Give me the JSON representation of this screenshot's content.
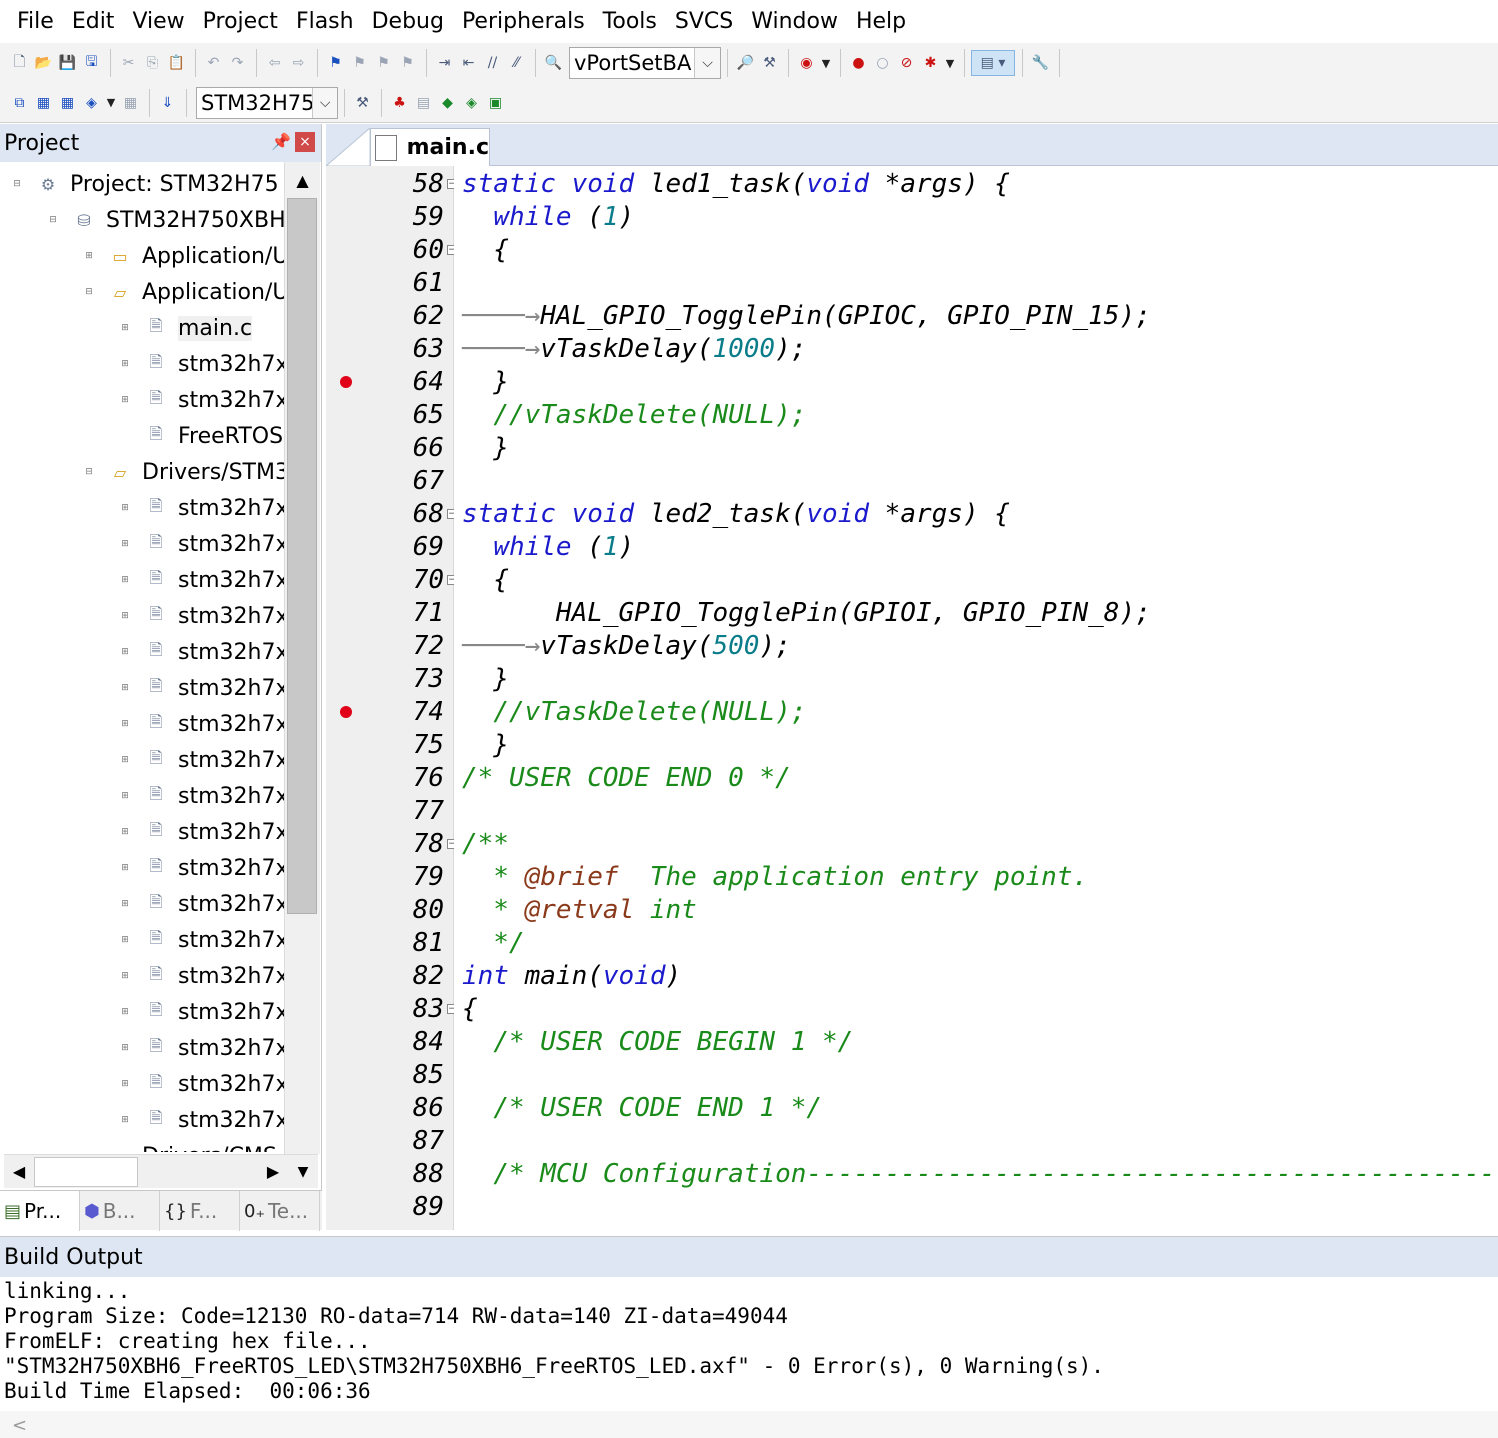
{
  "menu": [
    "File",
    "Edit",
    "View",
    "Project",
    "Flash",
    "Debug",
    "Peripherals",
    "Tools",
    "SVCS",
    "Window",
    "Help"
  ],
  "toolbar1": {
    "function_combo": "vPortSetBA"
  },
  "toolbar2": {
    "target_combo": "STM32H75"
  },
  "project_panel": {
    "title": "Project",
    "tree": [
      {
        "label": "Project: STM32H75",
        "type": "project",
        "level": 0
      },
      {
        "label": "STM32H750XBH",
        "type": "target",
        "level": 1
      },
      {
        "label": "Application/U",
        "type": "folder",
        "level": 2
      },
      {
        "label": "Application/U",
        "type": "folder-open",
        "level": 2
      },
      {
        "label": "main.c",
        "type": "file",
        "level": 3,
        "selected": true
      },
      {
        "label": "stm32h7x",
        "type": "file",
        "level": 3
      },
      {
        "label": "stm32h7x",
        "type": "file",
        "level": 3
      },
      {
        "label": "FreeRTOS",
        "type": "file",
        "level": 3
      },
      {
        "label": "Drivers/STM3",
        "type": "folder-open",
        "level": 2
      },
      {
        "label": "stm32h7x",
        "type": "file",
        "level": 3
      },
      {
        "label": "stm32h7x",
        "type": "file",
        "level": 3
      },
      {
        "label": "stm32h7x",
        "type": "file",
        "level": 3
      },
      {
        "label": "stm32h7x",
        "type": "file",
        "level": 3
      },
      {
        "label": "stm32h7x",
        "type": "file",
        "level": 3
      },
      {
        "label": "stm32h7x",
        "type": "file",
        "level": 3
      },
      {
        "label": "stm32h7x",
        "type": "file",
        "level": 3
      },
      {
        "label": "stm32h7x",
        "type": "file",
        "level": 3
      },
      {
        "label": "stm32h7x",
        "type": "file",
        "level": 3
      },
      {
        "label": "stm32h7x",
        "type": "file",
        "level": 3
      },
      {
        "label": "stm32h7x",
        "type": "file",
        "level": 3
      },
      {
        "label": "stm32h7x",
        "type": "file",
        "level": 3
      },
      {
        "label": "stm32h7x",
        "type": "file",
        "level": 3
      },
      {
        "label": "stm32h7x",
        "type": "file",
        "level": 3
      },
      {
        "label": "stm32h7x",
        "type": "file",
        "level": 3
      },
      {
        "label": "stm32h7x",
        "type": "file",
        "level": 3
      },
      {
        "label": "stm32h7x",
        "type": "file",
        "level": 3
      },
      {
        "label": "stm32h7x",
        "type": "file",
        "level": 3
      },
      {
        "label": "Drivers/CMS",
        "type": "folder",
        "level": 2
      }
    ],
    "bottom_tabs": [
      "Pr...",
      "B...",
      "F...",
      "Te..."
    ]
  },
  "editor": {
    "active_tab": "main.c",
    "lines": [
      {
        "n": "58",
        "bp": false,
        "fold": true,
        "tokens": [
          [
            "kw",
            "static void "
          ],
          [
            "",
            "led1_task("
          ],
          [
            "kw",
            "void "
          ],
          [
            "",
            "*args) {"
          ]
        ]
      },
      {
        "n": "59",
        "bp": false,
        "fold": false,
        "tokens": [
          [
            "",
            "  "
          ],
          [
            "kw",
            "while "
          ],
          [
            "",
            "("
          ],
          [
            "num",
            "1"
          ],
          [
            "",
            ")"
          ]
        ]
      },
      {
        "n": "60",
        "bp": false,
        "fold": true,
        "tokens": [
          [
            "",
            "  {"
          ]
        ]
      },
      {
        "n": "61",
        "bp": false,
        "fold": false,
        "tokens": [
          [
            "",
            "    "
          ]
        ]
      },
      {
        "n": "62",
        "bp": false,
        "fold": false,
        "tokens": [
          [
            "arrow",
            "────→"
          ],
          [
            "",
            "HAL_GPIO_TogglePin(GPIOC, GPIO_PIN_15);"
          ]
        ]
      },
      {
        "n": "63",
        "bp": false,
        "fold": false,
        "tokens": [
          [
            "arrow",
            "────→"
          ],
          [
            "",
            "vTaskDelay("
          ],
          [
            "num",
            "1000"
          ],
          [
            "",
            ");"
          ]
        ]
      },
      {
        "n": "64",
        "bp": true,
        "fold": false,
        "tokens": [
          [
            "",
            "  }"
          ]
        ]
      },
      {
        "n": "65",
        "bp": false,
        "fold": false,
        "tokens": [
          [
            "",
            "  "
          ],
          [
            "cm",
            "//vTaskDelete(NULL);"
          ]
        ]
      },
      {
        "n": "66",
        "bp": false,
        "fold": false,
        "tokens": [
          [
            "",
            "  }"
          ]
        ]
      },
      {
        "n": "67",
        "bp": false,
        "fold": false,
        "tokens": [
          [
            "",
            ""
          ]
        ]
      },
      {
        "n": "68",
        "bp": false,
        "fold": true,
        "tokens": [
          [
            "kw",
            "static void "
          ],
          [
            "",
            "led2_task("
          ],
          [
            "kw",
            "void "
          ],
          [
            "",
            "*args) {"
          ]
        ]
      },
      {
        "n": "69",
        "bp": false,
        "fold": false,
        "tokens": [
          [
            "",
            "  "
          ],
          [
            "kw",
            "while "
          ],
          [
            "",
            "("
          ],
          [
            "num",
            "1"
          ],
          [
            "",
            ")"
          ]
        ]
      },
      {
        "n": "70",
        "bp": false,
        "fold": true,
        "tokens": [
          [
            "",
            "  {"
          ]
        ]
      },
      {
        "n": "71",
        "bp": false,
        "fold": false,
        "tokens": [
          [
            "",
            "      HAL_GPIO_TogglePin(GPIOI, GPIO_PIN_8);"
          ]
        ]
      },
      {
        "n": "72",
        "bp": false,
        "fold": false,
        "tokens": [
          [
            "arrow",
            "────→"
          ],
          [
            "",
            "vTaskDelay("
          ],
          [
            "num",
            "500"
          ],
          [
            "",
            ");"
          ]
        ]
      },
      {
        "n": "73",
        "bp": false,
        "fold": false,
        "tokens": [
          [
            "",
            "  }"
          ]
        ]
      },
      {
        "n": "74",
        "bp": true,
        "fold": false,
        "tokens": [
          [
            "",
            "  "
          ],
          [
            "cm",
            "//vTaskDelete(NULL);"
          ]
        ]
      },
      {
        "n": "75",
        "bp": false,
        "fold": false,
        "tokens": [
          [
            "",
            "  }"
          ]
        ]
      },
      {
        "n": "76",
        "bp": false,
        "fold": false,
        "tokens": [
          [
            "cm",
            "/* USER CODE END 0 */"
          ]
        ]
      },
      {
        "n": "77",
        "bp": false,
        "fold": false,
        "tokens": [
          [
            "",
            ""
          ]
        ]
      },
      {
        "n": "78",
        "bp": false,
        "fold": true,
        "tokens": [
          [
            "cm",
            "/**"
          ]
        ]
      },
      {
        "n": "79",
        "bp": false,
        "fold": false,
        "tokens": [
          [
            "cm",
            "  * "
          ],
          [
            "tag",
            "@brief"
          ],
          [
            "cm",
            "  The application entry point."
          ]
        ]
      },
      {
        "n": "80",
        "bp": false,
        "fold": false,
        "tokens": [
          [
            "cm",
            "  * "
          ],
          [
            "tag",
            "@retval"
          ],
          [
            "cm",
            " int"
          ]
        ]
      },
      {
        "n": "81",
        "bp": false,
        "fold": false,
        "tokens": [
          [
            "cm",
            "  */"
          ]
        ]
      },
      {
        "n": "82",
        "bp": false,
        "fold": false,
        "tokens": [
          [
            "kw",
            "int "
          ],
          [
            "",
            "main("
          ],
          [
            "kw",
            "void"
          ],
          [
            "",
            ")"
          ]
        ]
      },
      {
        "n": "83",
        "bp": false,
        "fold": true,
        "tokens": [
          [
            "",
            "{"
          ]
        ]
      },
      {
        "n": "84",
        "bp": false,
        "fold": false,
        "tokens": [
          [
            "",
            "  "
          ],
          [
            "cm",
            "/* USER CODE BEGIN 1 */"
          ]
        ]
      },
      {
        "n": "85",
        "bp": false,
        "fold": false,
        "tokens": [
          [
            "",
            ""
          ]
        ]
      },
      {
        "n": "86",
        "bp": false,
        "fold": false,
        "tokens": [
          [
            "",
            "  "
          ],
          [
            "cm",
            "/* USER CODE END 1 */"
          ]
        ]
      },
      {
        "n": "87",
        "bp": false,
        "fold": false,
        "tokens": [
          [
            "",
            ""
          ]
        ]
      },
      {
        "n": "88",
        "bp": false,
        "fold": false,
        "tokens": [
          [
            "",
            "  "
          ],
          [
            "cm",
            "/* MCU Configuration--------------------------------------------------------"
          ]
        ]
      },
      {
        "n": "89",
        "bp": false,
        "fold": false,
        "tokens": [
          [
            "",
            ""
          ]
        ]
      }
    ]
  },
  "build_output": {
    "title": "Build Output",
    "lines": [
      "linking...",
      "Program Size: Code=12130 RO-data=714 RW-data=140 ZI-data=49044",
      "FromELF: creating hex file...",
      "\"STM32H750XBH6_FreeRTOS_LED\\STM32H750XBH6_FreeRTOS_LED.axf\" - 0 Error(s), 0 Warning(s).",
      "Build Time Elapsed:  00:06:36"
    ]
  }
}
